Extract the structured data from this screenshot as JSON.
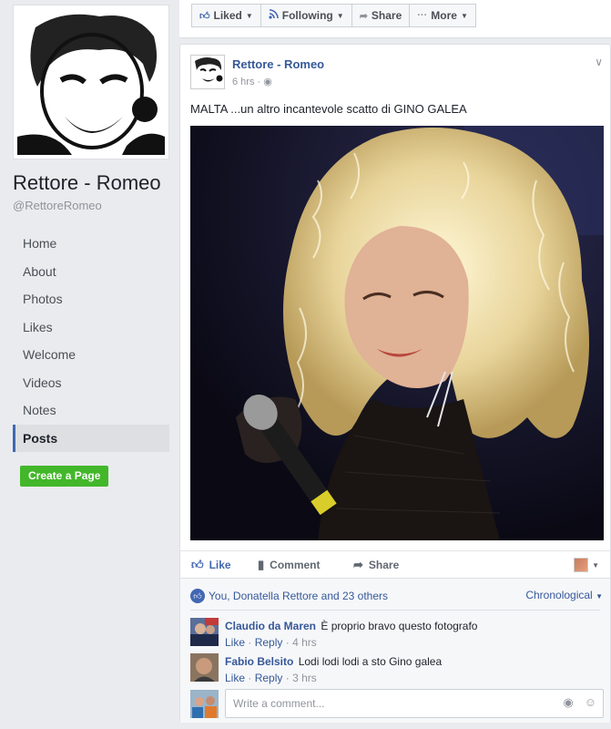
{
  "page": {
    "name": "Rettore - Romeo",
    "handle": "@RettoreRomeo"
  },
  "nav": {
    "items": [
      "Home",
      "About",
      "Photos",
      "Likes",
      "Welcome",
      "Videos",
      "Notes",
      "Posts"
    ],
    "active": "Posts",
    "create_label": "Create a Page"
  },
  "topbar": {
    "liked": "Liked",
    "following": "Following",
    "share": "Share",
    "more": "More"
  },
  "post": {
    "author": "Rettore - Romeo",
    "time": "6 hrs",
    "text": "MALTA ...un altro incantevole scatto di GINO GALEA",
    "actions": {
      "like": "Like",
      "comment": "Comment",
      "share": "Share"
    }
  },
  "comments": {
    "likes_summary": "You, Donatella Rettore and 23 others",
    "order": "Chronological",
    "items": [
      {
        "name": "Claudio da Maren",
        "text": "È proprio bravo questo fotografo",
        "like": "Like",
        "reply": "Reply",
        "time": "4 hrs"
      },
      {
        "name": "Fabio Belsito",
        "text": "Lodi lodi lodi a sto Gino galea",
        "like": "Like",
        "reply": "Reply",
        "time": "3 hrs"
      }
    ],
    "write_placeholder": "Write a comment..."
  },
  "colors": {
    "link": "#365899",
    "accent": "#4267b2",
    "create_button": "#42b72a"
  },
  "icons": {
    "liked": "thumbs-up-icon",
    "following": "rss-icon",
    "share": "share-arrow-icon",
    "more": "dots-icon",
    "globe": "globe-icon",
    "chevron": "chevron-down-icon",
    "camera": "camera-icon",
    "emoji": "smiley-icon"
  }
}
